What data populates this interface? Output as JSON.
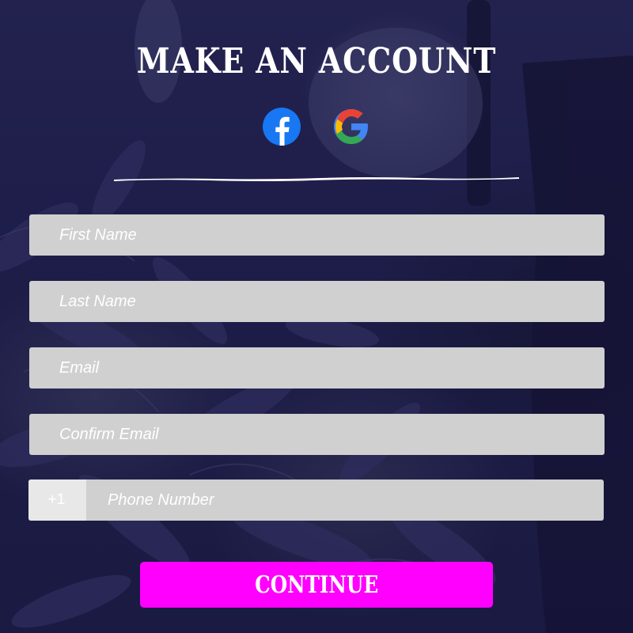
{
  "header": {
    "title": "MAKE AN ACCOUNT"
  },
  "social": [
    {
      "provider": "Facebook",
      "icon": "facebook-icon",
      "color": "#1877f2"
    },
    {
      "provider": "Google",
      "icon": "google-icon",
      "colors": [
        "#4285f4",
        "#ea4335",
        "#fbbc05",
        "#34a853"
      ]
    }
  ],
  "form": {
    "first_name": {
      "placeholder": "First Name",
      "value": ""
    },
    "last_name": {
      "placeholder": "Last Name",
      "value": ""
    },
    "email": {
      "placeholder": "Email",
      "value": ""
    },
    "confirm_email": {
      "placeholder": "Confirm Email",
      "value": ""
    },
    "phone": {
      "country_code": "+1",
      "placeholder": "Phone Number",
      "value": ""
    }
  },
  "actions": {
    "continue_label": "CONTINUE"
  },
  "colors": {
    "accent": "#ff00ff",
    "field_bg": "#d0d0d0",
    "overlay": "#1c1b45",
    "text": "#ffffff"
  }
}
